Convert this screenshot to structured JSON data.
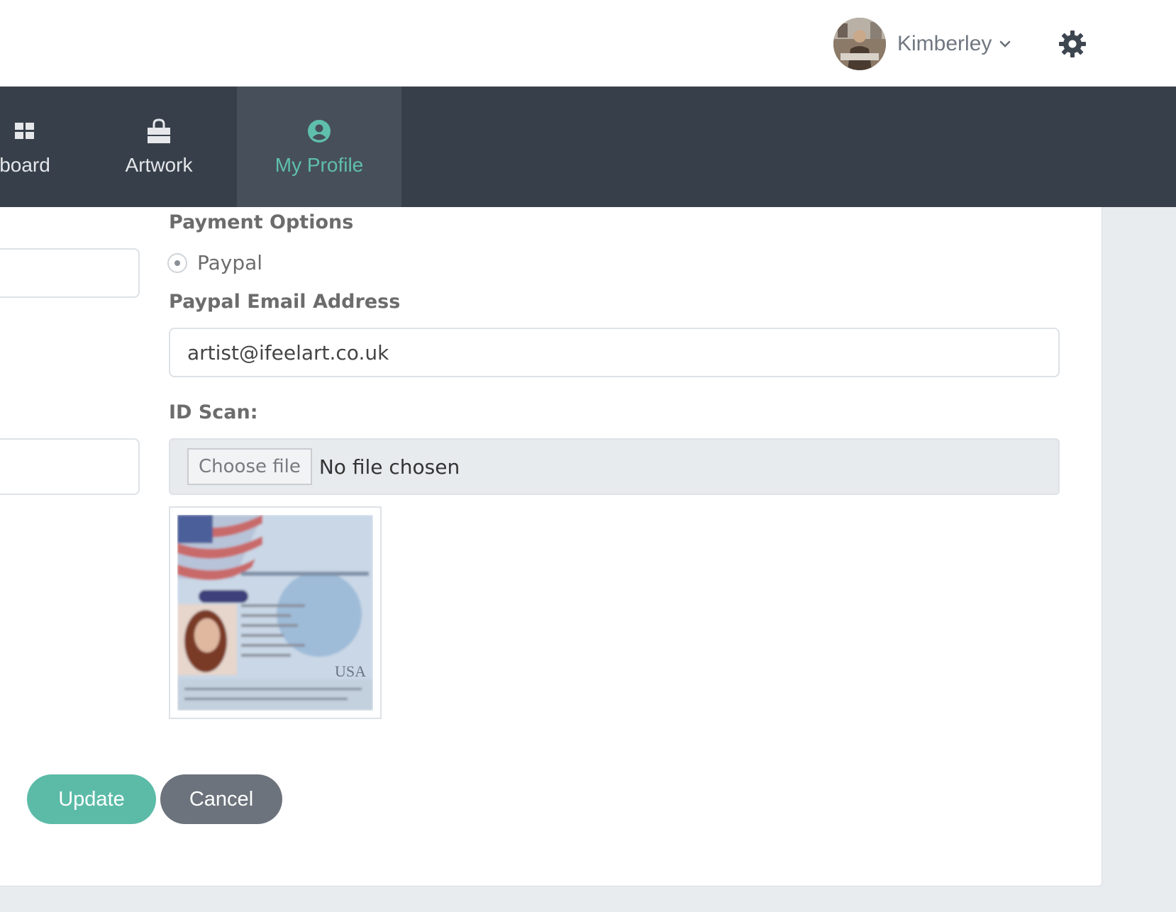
{
  "header": {
    "user_name": "Kimberley",
    "avatar_icon": "user-avatar-photo",
    "caret_icon": "chevron-down-icon",
    "settings_icon": "gear-icon"
  },
  "nav": {
    "items": [
      {
        "label": "board",
        "icon": "dashboard-icon",
        "active": false
      },
      {
        "label": "Artwork",
        "icon": "shopping-bag-icon",
        "active": false
      },
      {
        "label": "My Profile",
        "icon": "user-circle-icon",
        "active": true
      }
    ],
    "active_color": "#5fbfad"
  },
  "form": {
    "payment_options_label": "Payment Options",
    "paypal_option_label": "Paypal",
    "paypal_email_label": "Paypal Email Address",
    "paypal_email_value": "artist@ifeelart.co.uk",
    "id_scan_label": "ID Scan:",
    "choose_file_label": "Choose file",
    "file_status": "No file chosen",
    "id_scan_caption": "USA"
  },
  "actions": {
    "update_label": "Update",
    "cancel_label": "Cancel",
    "update_color": "#5bbba7",
    "cancel_color": "#6c737c"
  }
}
